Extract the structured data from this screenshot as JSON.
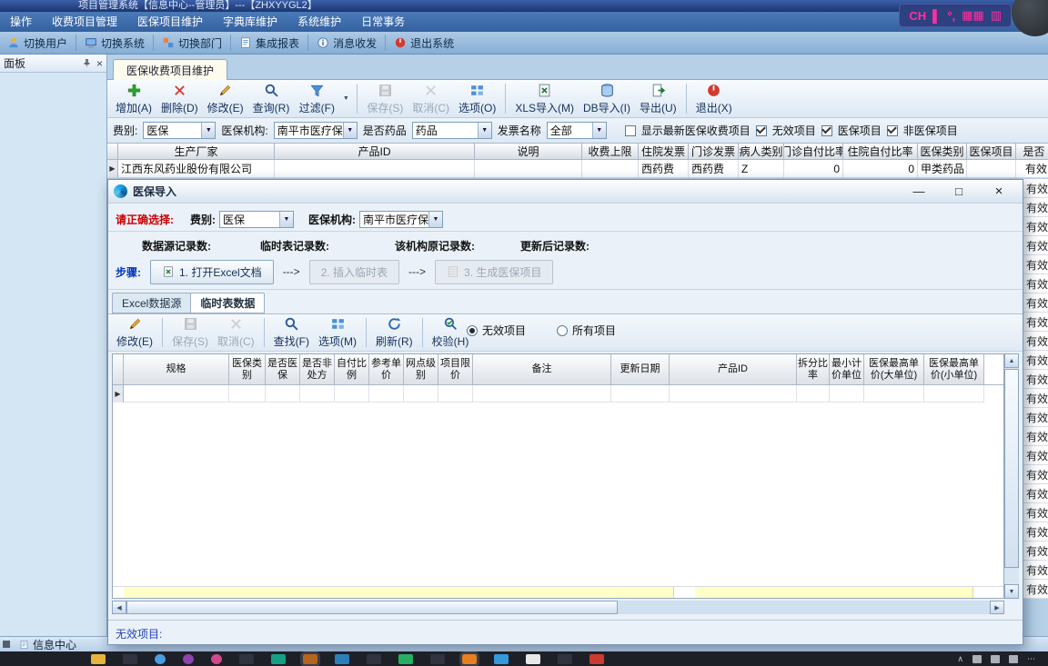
{
  "colors": {
    "accent_magenta": "#ff2fa0",
    "titlebar_blue": "#1c3570",
    "menubar_blue": "#35609e",
    "prompt_red": "#cc0000",
    "link_blue": "#2244bb",
    "grid_summary_yellow": "#ffffc8"
  },
  "icons": {
    "toolbar": [
      "add-icon",
      "delete-icon",
      "edit-icon",
      "search-icon",
      "filter-icon",
      "save-icon",
      "cancel-icon",
      "options-icon",
      "xls-import-icon",
      "db-import-icon",
      "export-icon",
      "exit-icon"
    ],
    "dialog_toolbar": [
      "edit-icon",
      "save-icon",
      "cancel-icon",
      "find-icon",
      "options-icon",
      "refresh-icon",
      "verify-icon"
    ],
    "quickbar": [
      "user-icon",
      "monitor-icon",
      "department-icon",
      "report-icon",
      "message-icon",
      "exit-icon"
    ]
  },
  "titlebar": {
    "title": "项目管理系统【信息中心--管理员】---【ZHXYYGL2】",
    "ime_label": "CH"
  },
  "menubar": {
    "items": [
      "操作",
      "收费项目管理",
      "医保项目维护",
      "字典库维护",
      "系统维护",
      "日常事务"
    ]
  },
  "quickbar": {
    "items": [
      "切换用户",
      "切换系统",
      "切换部门",
      "集成报表",
      "消息收发",
      "退出系统"
    ]
  },
  "panel": {
    "title": "面板"
  },
  "main": {
    "tab": "医保收费项目维护",
    "toolbar": {
      "add": "增加(A)",
      "del": "删除(D)",
      "edit": "修改(E)",
      "query": "查询(R)",
      "filter": "过滤(F)",
      "save": "保存(S)",
      "cancel": "取消(C)",
      "options": "选项(O)",
      "xls": "XLS导入(M)",
      "db": "DB导入(I)",
      "export": "导出(U)",
      "exit": "退出(X)"
    },
    "filters": {
      "fee_label": "费别:",
      "fee_value": "医保",
      "org_label": "医保机构:",
      "org_value": "南平市医疗保障",
      "drug_label": "是否药品",
      "drug_value": "药品",
      "invoice_label": "发票名称",
      "invoice_value": "全部",
      "cb_latest": {
        "label": "显示最新医保收费项目",
        "checked": false
      },
      "cb_invalid": {
        "label": "无效项目",
        "checked": true
      },
      "cb_medins": {
        "label": "医保项目",
        "checked": true
      },
      "cb_nonmedins": {
        "label": "非医保项目",
        "checked": true
      }
    },
    "grid": {
      "columns": [
        "生产厂家",
        "产品ID",
        "说明",
        "收费上限",
        "住院发票",
        "门诊发票",
        "病人类别",
        "门诊自付比率",
        "住院自付比率",
        "医保类别",
        "医保项目",
        "是否"
      ],
      "row": {
        "manufacturer": "江西东风药业股份有限公司",
        "product_id": "",
        "desc": "",
        "fee_cap": "",
        "inpatient_invoice": "西药费",
        "outpatient_invoice": "西药费",
        "patient_type": "Z",
        "outpatient_ratio": "0",
        "inpatient_ratio": "0",
        "ins_type": "甲类药品",
        "ins_item": "",
        "valid": "有效"
      }
    },
    "side_value": "有效"
  },
  "dialog": {
    "title": "医保导入",
    "window_buttons": {
      "minimize": "—",
      "maximize": "□",
      "close": "×"
    },
    "prompt": "请正确选择:",
    "fee_label": "费别:",
    "fee_value": "医保",
    "org_label": "医保机构:",
    "org_value": "南平市医疗保障",
    "stats": {
      "source": "数据源记录数:",
      "temp": "临时表记录数:",
      "original": "该机构原记录数:",
      "updated": "更新后记录数:"
    },
    "steps_label": "步骤:",
    "step1": "1. 打开Excel文档",
    "step2": "2. 插入临时表",
    "step3": "3. 生成医保项目",
    "arrow": "--->",
    "tabs": {
      "excel": "Excel数据源",
      "temp": "临时表数据"
    },
    "toolbar": {
      "edit": "修改(E)",
      "save": "保存(S)",
      "cancel": "取消(C)",
      "find": "查找(F)",
      "options": "选项(M)",
      "refresh": "刷新(R)",
      "verify": "校验(H)"
    },
    "radio_invalid": {
      "label": "无效项目",
      "checked": true
    },
    "radio_all": {
      "label": "所有项目",
      "checked": false
    },
    "grid": {
      "columns": [
        "规格",
        "医保类别",
        "是否医保",
        "是否非处方",
        "自付比例",
        "参考单价",
        "网点级别",
        "项目限价",
        "备注",
        "更新日期",
        "产品ID",
        "拆分比率",
        "最小计价单位",
        "医保最高单价(大单位)",
        "医保最高单价(小单位)"
      ]
    },
    "footer_label": "无效项目:"
  },
  "statusbar": {
    "tab": "信息中心"
  }
}
